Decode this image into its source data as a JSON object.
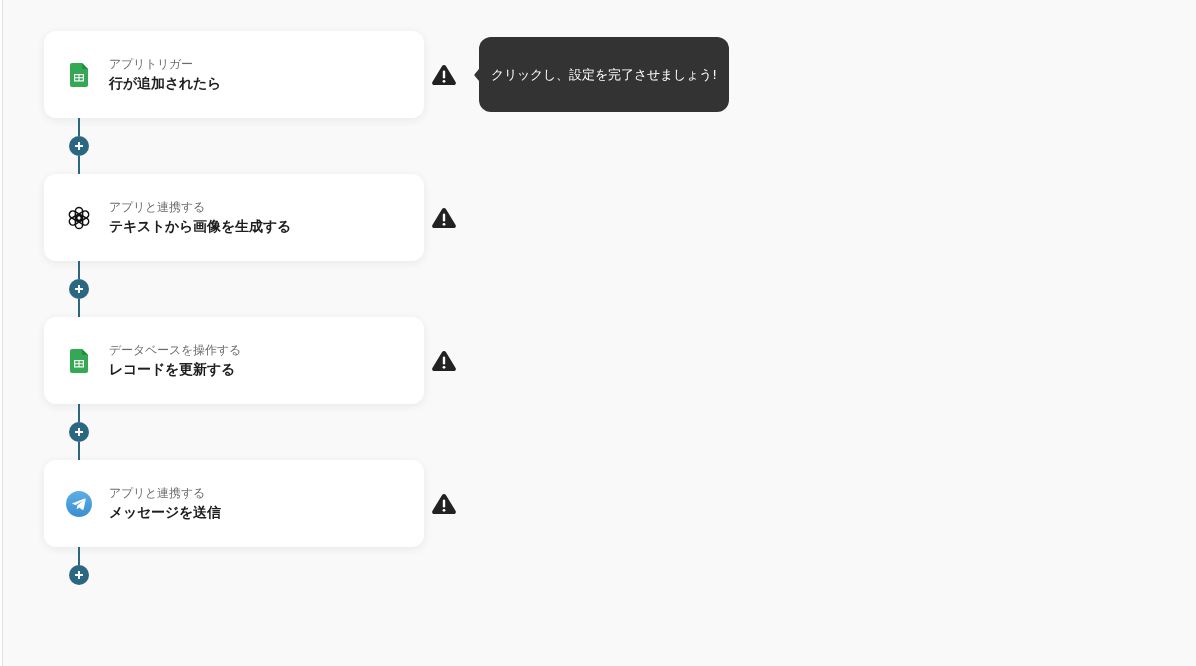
{
  "steps": [
    {
      "kind": "sheets",
      "subtitle": "アプリトリガー",
      "title": "行が追加されたら",
      "warning": true,
      "tooltip": "クリックし、設定を完了させましょう!"
    },
    {
      "kind": "openai",
      "subtitle": "アプリと連携する",
      "title": "テキストから画像を生成する",
      "warning": true
    },
    {
      "kind": "sheets",
      "subtitle": "データベースを操作する",
      "title": "レコードを更新する",
      "warning": true
    },
    {
      "kind": "telegram",
      "subtitle": "アプリと連携する",
      "title": "メッセージを送信",
      "warning": true
    }
  ]
}
